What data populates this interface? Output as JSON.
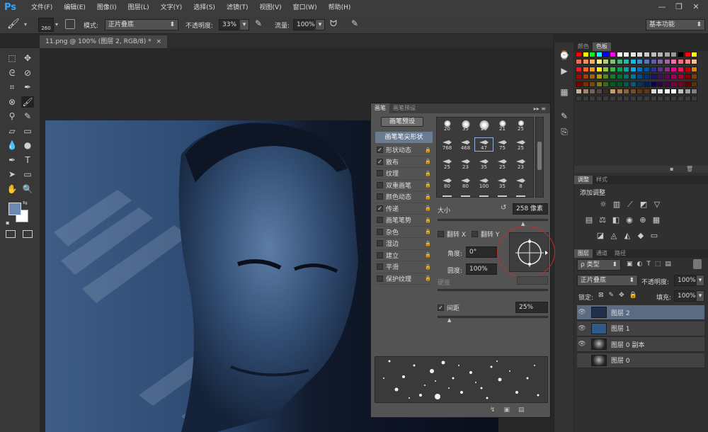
{
  "app": {
    "logo": "Ps",
    "window_controls": [
      "—",
      "❐",
      "✕"
    ]
  },
  "menu": [
    "文件(F)",
    "编辑(E)",
    "图像(I)",
    "图层(L)",
    "文字(Y)",
    "选择(S)",
    "滤镜(T)",
    "视图(V)",
    "窗口(W)",
    "帮助(H)"
  ],
  "options": {
    "brush_size": "260",
    "mode_label": "模式:",
    "mode_value": "正片叠底",
    "opacity_label": "不透明度:",
    "opacity_value": "33%",
    "flow_label": "流量:",
    "flow_value": "100%",
    "workspace": "基本功能"
  },
  "document": {
    "tab_title": "11.png @ 100% (图层 2, RGB/8) *",
    "close": "×"
  },
  "colors": {
    "foreground": "#6c8aaf",
    "background": "#ffffff",
    "canvas_blue": "#3e5d86"
  },
  "brush_panel": {
    "tabs": [
      "画笔",
      "画笔预设"
    ],
    "preset_button": "画笔预设",
    "tip_shape": "画笔笔尖形状",
    "options": [
      {
        "label": "形状动态",
        "checked": true
      },
      {
        "label": "散布",
        "checked": true
      },
      {
        "label": "纹理",
        "checked": false
      },
      {
        "label": "双重画笔",
        "checked": false
      },
      {
        "label": "颜色动态",
        "checked": false
      },
      {
        "label": "传递",
        "checked": true
      },
      {
        "label": "画笔笔势",
        "checked": false
      },
      {
        "label": "杂色",
        "checked": false
      },
      {
        "label": "湿边",
        "checked": false
      },
      {
        "label": "建立",
        "checked": false
      },
      {
        "label": "平滑",
        "checked": false
      },
      {
        "label": "保护纹理",
        "checked": false
      }
    ],
    "tip_sizes": [
      [
        "20",
        "35",
        "25",
        "21",
        "25"
      ],
      [
        "768",
        "468",
        "47",
        "75",
        "25"
      ],
      [
        "25",
        "23",
        "35",
        "25",
        "23"
      ],
      [
        "80",
        "80",
        "100",
        "35",
        "8"
      ]
    ],
    "size_label": "大小",
    "size_value": "258 像素",
    "flipx": "翻转 X",
    "flipy": "翻转 Y",
    "angle_label": "角度:",
    "angle_value": "0°",
    "roundness_label": "圆度:",
    "roundness_value": "100%",
    "hardness_label": "硬度",
    "spacing_label": "间距",
    "spacing_value": "25%",
    "spacing_checked": true
  },
  "swatches_panel": {
    "tabs": [
      "颜色",
      "色板"
    ]
  },
  "adjust_panel": {
    "tabs": [
      "调整",
      "样式"
    ],
    "title": "添加调整"
  },
  "layers_panel": {
    "tabs": [
      "图层",
      "通道",
      "路径"
    ],
    "filter": "ρ 类型",
    "blend": "正片叠底",
    "opacity_label": "不透明度:",
    "opacity_value": "100%",
    "lock_label": "锁定:",
    "fill_label": "填充:",
    "fill_value": "100%",
    "layers": [
      {
        "name": "图层 2",
        "selected": true,
        "visible": true
      },
      {
        "name": "图层 1",
        "selected": false,
        "visible": true
      },
      {
        "name": "图层 0 副本",
        "selected": false,
        "visible": true
      },
      {
        "name": "图层 0",
        "selected": false,
        "visible": false
      }
    ]
  }
}
